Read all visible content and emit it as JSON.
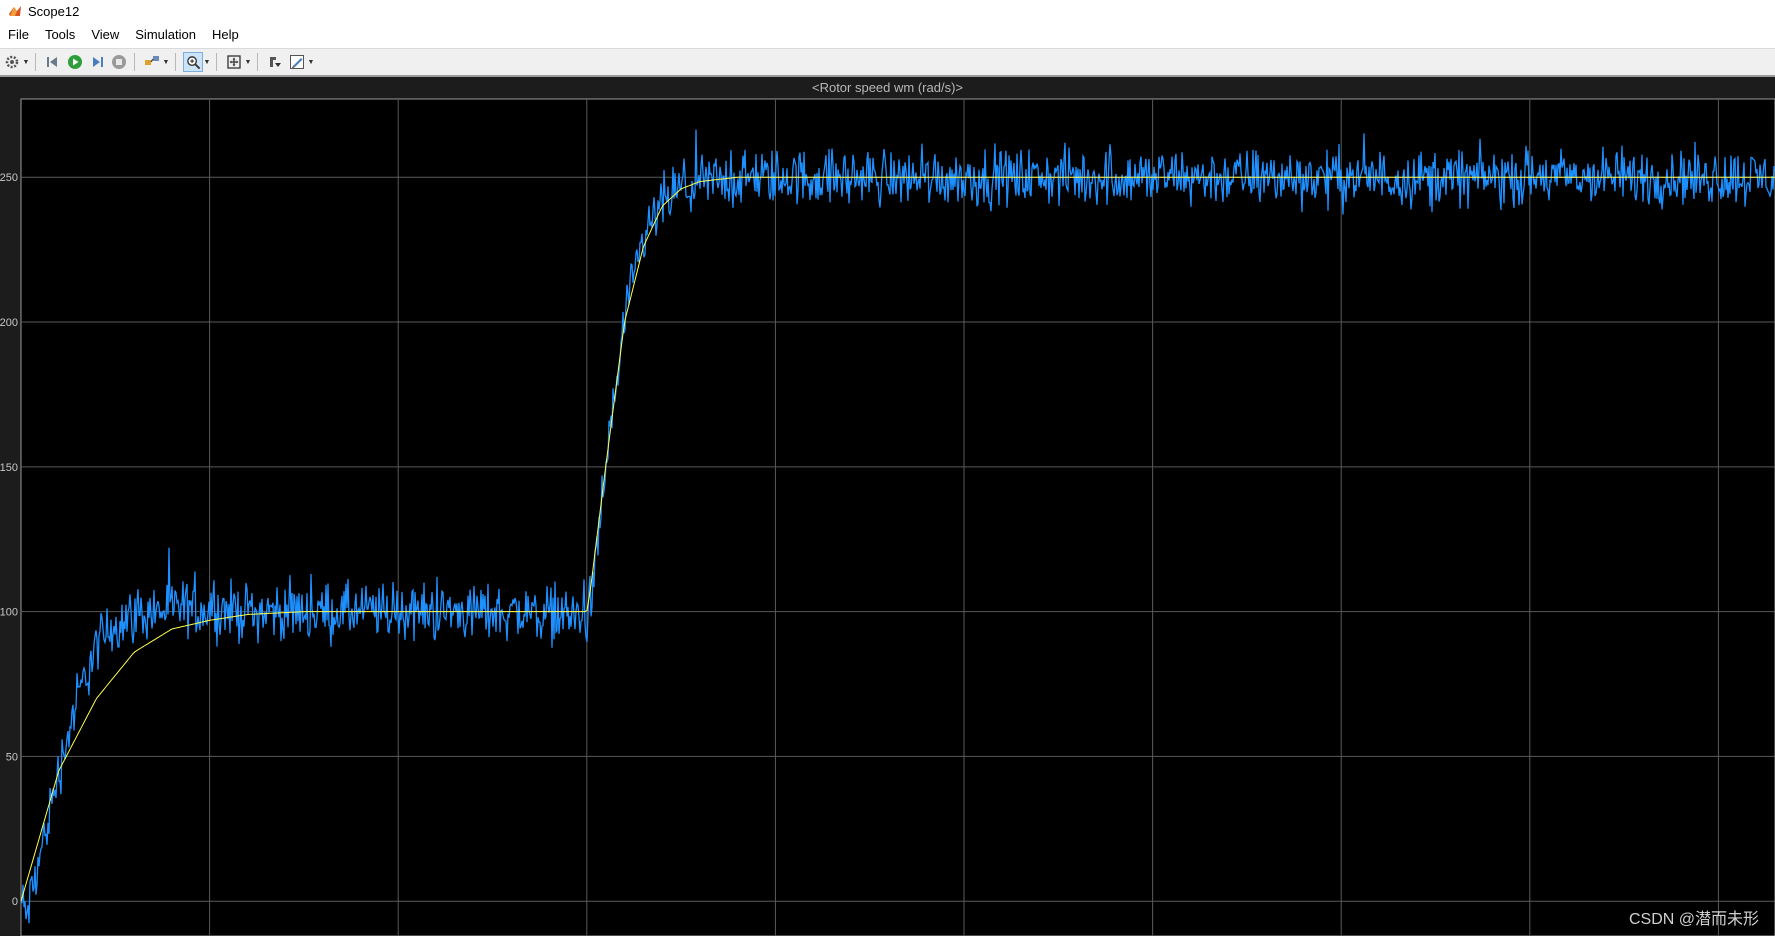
{
  "window": {
    "title": "Scope12"
  },
  "menu": {
    "items": [
      "File",
      "Tools",
      "View",
      "Simulation",
      "Help"
    ]
  },
  "toolbar": {
    "buttons": [
      "settings-icon",
      "step-back-icon",
      "run-icon",
      "step-forward-icon",
      "stop-icon",
      "highlight-simulink-block-icon",
      "zoom-icon",
      "scale-axes-icon",
      "cursor-measure-icon",
      "edit-icon"
    ],
    "active": "zoom-icon"
  },
  "scope": {
    "title": "<Rotor speed wm (rad/s)>",
    "background": "#000000",
    "grid_color": "#5a5a5a",
    "signal_colors": {
      "reference": "#ffff4d",
      "measured": "#1e90ff"
    }
  },
  "chart_data": {
    "type": "line",
    "title": "<Rotor speed wm (rad/s)>",
    "xlabel": "",
    "ylabel": "",
    "ylim": [
      -12,
      277
    ],
    "yticks": [
      0,
      50,
      100,
      150,
      200,
      250
    ],
    "yticklabels": [
      "0",
      "50",
      "100",
      "150",
      "200",
      "250"
    ],
    "grid": true,
    "x_divisions": 9.3,
    "series": [
      {
        "color": "#ffff4d",
        "x": [
          0,
          0.2,
          0.4,
          0.6,
          0.8,
          1.0,
          1.2,
          1.5,
          2.0,
          2.5,
          3.0,
          3.02,
          3.1,
          3.2,
          3.3,
          3.4,
          3.5,
          3.6,
          3.8,
          4.0,
          4.5,
          5.0,
          6.0,
          7.0,
          8.0,
          9.3
        ],
        "values": [
          0,
          45,
          70,
          86,
          94,
          97,
          99,
          100,
          100,
          100,
          100,
          108,
          150,
          200,
          226,
          240,
          246,
          248.5,
          250,
          250,
          250,
          250,
          250,
          250,
          250,
          250
        ]
      },
      {
        "color": "#1e90ff",
        "noise_amplitude": 8,
        "x": [
          0,
          0.03,
          0.1,
          0.2,
          0.3,
          0.4,
          0.5,
          0.6,
          0.8,
          1.0,
          1.2,
          1.5,
          2.0,
          2.5,
          2.9,
          3.0,
          3.03,
          3.1,
          3.2,
          3.3,
          3.4,
          3.5,
          3.7,
          4.0,
          5.0,
          6.0,
          7.0,
          8.0,
          9.3
        ],
        "values": [
          0,
          -5,
          15,
          45,
          70,
          88,
          96,
          99,
          101,
          101,
          100,
          100,
          100,
          100,
          99,
          98,
          105,
          150,
          200,
          228,
          241,
          246,
          249,
          250,
          250,
          250,
          250,
          250,
          250
        ]
      }
    ]
  },
  "watermark": "CSDN @潜而未形"
}
